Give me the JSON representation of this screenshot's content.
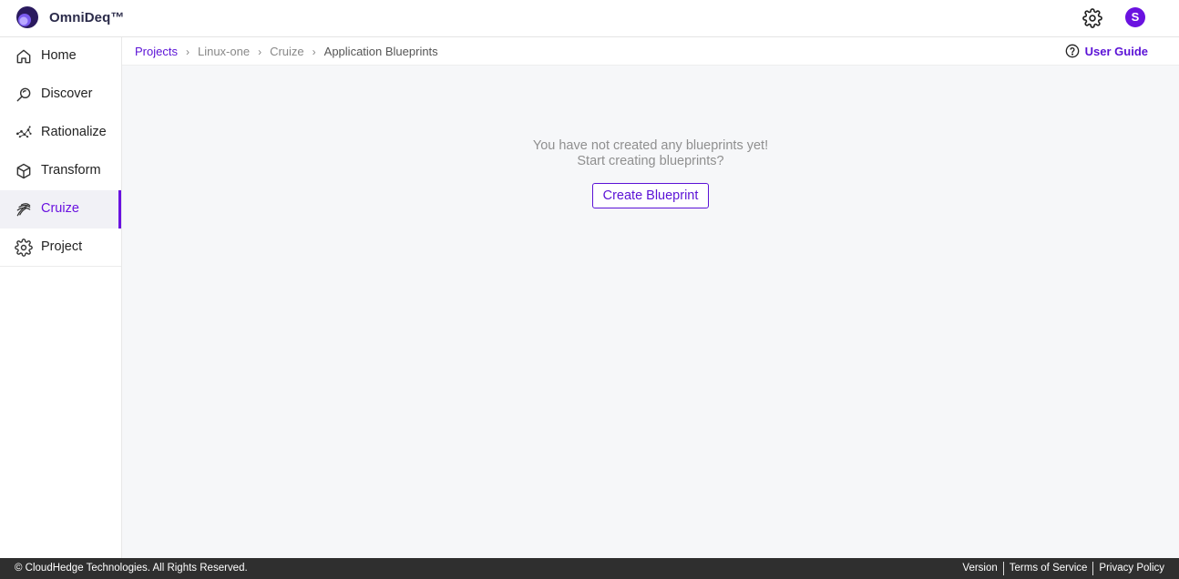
{
  "app": {
    "brand": "OmniDeq™",
    "avatar_initial": "S",
    "accent_color": "#6a12e0"
  },
  "sidebar": {
    "items": [
      {
        "label": "Home",
        "icon": "home-icon",
        "active": false
      },
      {
        "label": "Discover",
        "icon": "discover-icon",
        "active": false
      },
      {
        "label": "Rationalize",
        "icon": "rationalize-icon",
        "active": false
      },
      {
        "label": "Transform",
        "icon": "cube-icon",
        "active": false
      },
      {
        "label": "Cruize",
        "icon": "cruize-icon",
        "active": true
      },
      {
        "label": "Project",
        "icon": "gear-icon",
        "active": false
      }
    ]
  },
  "breadcrumb": {
    "items": [
      "Projects",
      "Linux-one",
      "Cruize",
      "Application Blueprints"
    ],
    "separator": "›"
  },
  "header_links": {
    "user_guide": "User Guide"
  },
  "empty_state": {
    "line1": "You have not created any blueprints yet!",
    "line2": "Start creating blueprints?",
    "button": "Create Blueprint"
  },
  "footer": {
    "copyright": "© CloudHedge Technologies. All Rights Reserved.",
    "links": [
      "Version",
      "Terms of Service",
      "Privacy Policy"
    ]
  }
}
